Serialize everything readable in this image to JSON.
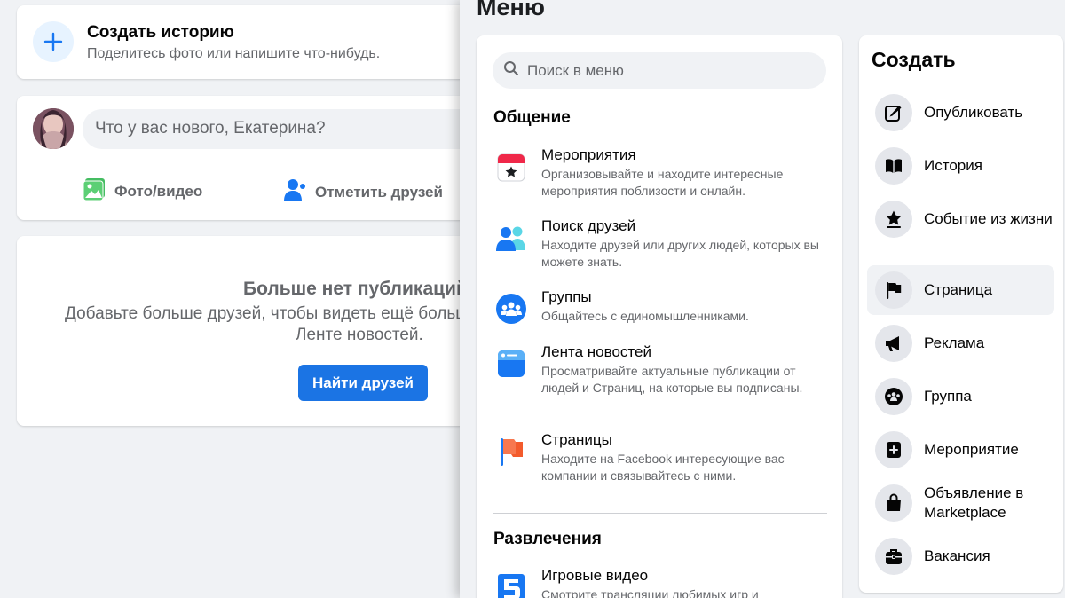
{
  "story": {
    "title": "Создать историю",
    "subtitle": "Поделитесь фото или напишите что-нибудь."
  },
  "composer": {
    "placeholder": "Что у вас нового, Екатерина?",
    "photo_label": "Фото/видео",
    "tag_label": "Отметить друзей"
  },
  "empty": {
    "title": "Больше нет публикаций",
    "line1": "Добавьте больше друзей, чтобы видеть ещё больше публикаций в",
    "line2": "Ленте новостей.",
    "button": "Найти друзей"
  },
  "menu": {
    "heading": "Меню",
    "search_placeholder": "Поиск в меню",
    "sections": [
      {
        "title": "Общение",
        "items": [
          {
            "title": "Мероприятия",
            "desc": "Организовывайте и находите интересные мероприятия поблизости и онлайн.",
            "icon": "calendar-icon"
          },
          {
            "title": "Поиск друзей",
            "desc": "Находите друзей или других людей, которых вы можете знать.",
            "icon": "friends-icon"
          },
          {
            "title": "Группы",
            "desc": "Общайтесь с единомышленниками.",
            "icon": "groups-icon"
          },
          {
            "title": "Лента новостей",
            "desc": "Просматривайте актуальные публикации от людей и Страниц, на которые вы подписаны.",
            "icon": "news-feed-icon"
          },
          {
            "title": "Страницы",
            "desc": "Находите на Facebook интересующие вас компании и связывайтесь с ними.",
            "icon": "pages-flag-icon"
          }
        ]
      },
      {
        "title": "Развлечения",
        "items": [
          {
            "title": "Игровые видео",
            "desc": "Смотрите трансляции любимых игр и",
            "icon": "gaming-video-icon"
          }
        ]
      }
    ]
  },
  "create": {
    "title": "Создать",
    "items": [
      {
        "label": "Опубликовать",
        "icon": "compose-icon"
      },
      {
        "label": "История",
        "icon": "book-icon"
      },
      {
        "label": "Событие из жизни",
        "icon": "life-event-star-icon"
      },
      {
        "label": "Страница",
        "icon": "page-flag-icon"
      },
      {
        "label": "Реклама",
        "icon": "megaphone-icon"
      },
      {
        "label": "Группа",
        "icon": "group-icon"
      },
      {
        "label": "Мероприятие",
        "icon": "calendar-plus-icon"
      },
      {
        "label": "Объявление в Marketplace",
        "icon": "shopping-bag-icon"
      },
      {
        "label": "Вакансия",
        "icon": "briefcase-icon"
      }
    ]
  },
  "colors": {
    "accent": "#1b74e4",
    "background": "#f0f2f5",
    "secondary_text": "#65676b"
  }
}
